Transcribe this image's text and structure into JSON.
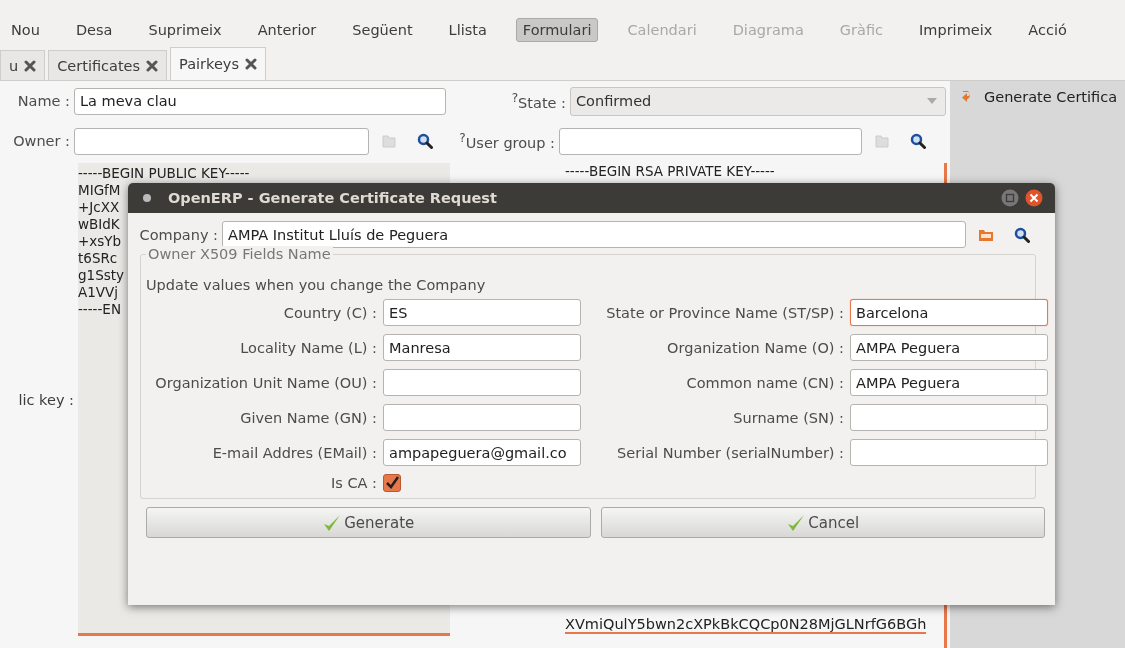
{
  "toolbar": [
    {
      "label": "Nou",
      "selected": false,
      "disabled": false
    },
    {
      "label": "Desa",
      "selected": false,
      "disabled": false
    },
    {
      "label": "Suprimeix",
      "selected": false,
      "disabled": false
    },
    {
      "label": "Anterior",
      "selected": false,
      "disabled": false
    },
    {
      "label": "Següent",
      "selected": false,
      "disabled": false
    },
    {
      "label": "Llista",
      "selected": false,
      "disabled": false
    },
    {
      "label": "Formulari",
      "selected": true,
      "disabled": false
    },
    {
      "label": "Calendari",
      "selected": false,
      "disabled": true
    },
    {
      "label": "Diagrama",
      "selected": false,
      "disabled": true
    },
    {
      "label": "Gràfic",
      "selected": false,
      "disabled": true
    },
    {
      "label": "Imprimeix",
      "selected": false,
      "disabled": false
    },
    {
      "label": "Acció",
      "selected": false,
      "disabled": false
    }
  ],
  "tabs": [
    {
      "label": "u",
      "selected": false
    },
    {
      "label": "Certificates",
      "selected": false
    },
    {
      "label": "Pairkeys",
      "selected": true
    }
  ],
  "form": {
    "name": {
      "label": "Name :",
      "value": "La meva clau"
    },
    "owner": {
      "label": "Owner :"
    },
    "state": {
      "label": "$^{?}$State :",
      "value": "Confirmed"
    },
    "user_group": {
      "label": "$^{?}$User group :"
    },
    "public_key": {
      "label": "lic key :",
      "lines": [
        "-----BEGIN PUBLIC KEY-----",
        "MIGfM",
        "+JcXX",
        "wBIdK",
        "+xsYb",
        "t6SRc",
        "g1Ssty",
        "A1VVj",
        "-----EN"
      ]
    },
    "private_key": {
      "first_line": "-----BEGIN RSA PRIVATE KEY-----",
      "last_line": "XVmiQulY5bwn2cXPkBkCQCp0N28MjGLNrfG6BGh"
    }
  },
  "side_panel": {
    "actions": [
      {
        "label": "Generate Certifica"
      }
    ]
  },
  "dialog": {
    "title": "OpenERP - Generate Certificate Request",
    "company": {
      "label": "Company :",
      "value": "AMPA Institut Lluís de Peguera"
    },
    "group_title": "Owner X509 Fields Name",
    "hint": "Update values when you change the Company",
    "fields": [
      {
        "label": "Country (C) :",
        "value": "ES",
        "focused": false
      },
      {
        "label": "State or Province Name (ST/SP) :",
        "value": "Barcelona",
        "focused": true
      },
      {
        "label": "Locality Name (L) :",
        "value": "Manresa",
        "focused": false
      },
      {
        "label": "Organization Name (O) :",
        "value": "AMPA Peguera",
        "focused": false
      },
      {
        "label": "Organization Unit Name (OU) :",
        "focused": false
      },
      {
        "label": "Common name (CN) :",
        "value": "AMPA Peguera",
        "focused": false
      },
      {
        "label": "Given Name (GN) :",
        "focused": false
      },
      {
        "label": "Surname (SN) :",
        "focused": false
      },
      {
        "label": "E-mail Addres (EMail) :",
        "value": "ampapeguera@gmail.co",
        "focused": false
      },
      {
        "label": "Serial Number (serialNumber) :",
        "focused": false
      }
    ],
    "is_ca": {
      "label": "Is CA :",
      "checked": true
    },
    "buttons": [
      {
        "label": "Generate"
      },
      {
        "label": "Cancel"
      }
    ]
  }
}
